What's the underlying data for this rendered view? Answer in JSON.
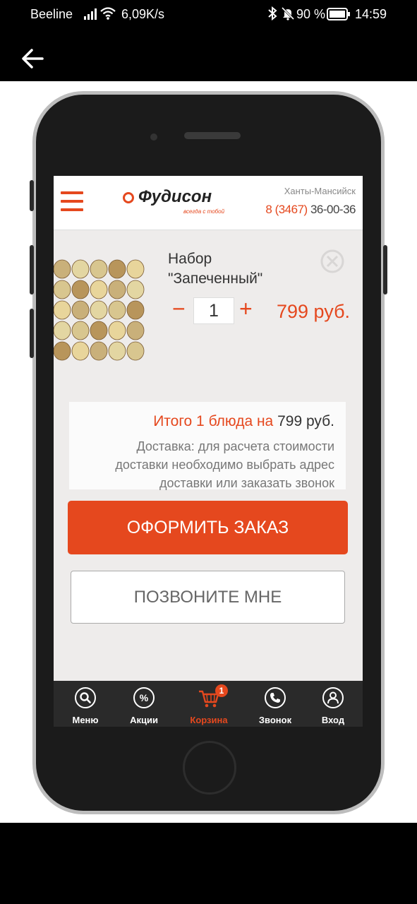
{
  "status_bar": {
    "carrier": "Beeline",
    "speed": "6,09K/s",
    "battery": "90 %",
    "time": "14:59"
  },
  "header": {
    "brand": "Фудисон",
    "tagline": "всегда с тобой",
    "city": "Ханты-Мансийск",
    "phone_code": "8 (3467)",
    "phone_number": " 36-00-36"
  },
  "cart_item": {
    "name_line1": "Набор",
    "name_line2": "\"Запеченный\"",
    "quantity": "1",
    "minus": "−",
    "plus": "+",
    "price": "799 руб."
  },
  "summary": {
    "total_label": "Итого 1 блюда на",
    "total_amount": " 799 руб.",
    "delivery_note": "Доставка: для расчета стоимости доставки необходимо выбрать адрес доставки или заказать звонок"
  },
  "buttons": {
    "order": "ОФОРМИТЬ ЗАКАЗ",
    "call_me": "ПОЗВОНИТЕ МНЕ"
  },
  "tabs": [
    {
      "label": "Меню",
      "icon": "search-icon"
    },
    {
      "label": "Акции",
      "icon": "percent-icon"
    },
    {
      "label": "Корзина",
      "icon": "cart-icon",
      "badge": "1",
      "active": true
    },
    {
      "label": "Звонок",
      "icon": "phone-icon"
    },
    {
      "label": "Вход",
      "icon": "user-icon"
    }
  ],
  "colors": {
    "accent": "#e5481e",
    "tabbar": "#2a2a2a",
    "screen_bg": "#eeeceb"
  }
}
